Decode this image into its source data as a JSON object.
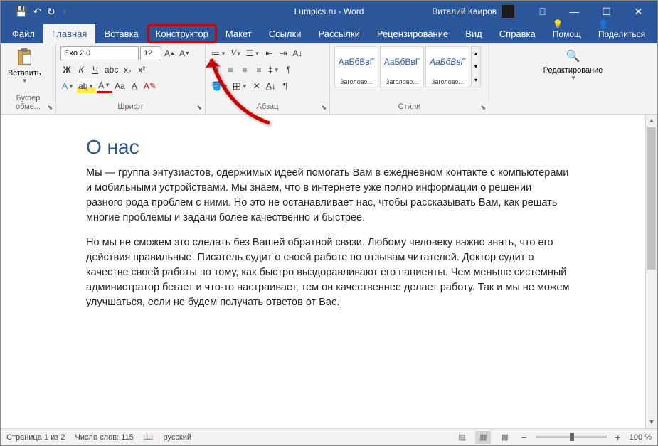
{
  "titlebar": {
    "title": "Lumpics.ru - Word",
    "user": "Виталий Каиров"
  },
  "tabs": {
    "file": "Файл",
    "home": "Главная",
    "insert": "Вставка",
    "design": "Конструктор",
    "layout": "Макет",
    "references": "Ссылки",
    "mailings": "Рассылки",
    "review": "Рецензирование",
    "view": "Вид",
    "help": "Справка",
    "tell_me": "Помощ",
    "share": "Поделиться"
  },
  "ribbon": {
    "clipboard": {
      "paste": "Вставить",
      "group": "Буфер обме..."
    },
    "font": {
      "name": "Exo 2.0",
      "size": "12",
      "group": "Шрифт",
      "bold": "Ж",
      "italic": "К",
      "underline": "Ч",
      "strike": "abc",
      "sub": "x₂",
      "sup": "x²",
      "grow": "A",
      "shrink": "A",
      "case": "Aa",
      "clear": "A"
    },
    "paragraph": {
      "group": "Абзац"
    },
    "styles": {
      "group": "Стили",
      "preview": "АаБбВвГ",
      "items": [
        "Заголово...",
        "Заголово...",
        "Заголово..."
      ]
    },
    "editing": {
      "label": "Редактирование"
    }
  },
  "document": {
    "heading": "О нас",
    "p1": "Мы — группа энтузиастов, одержимых идеей помогать Вам в ежедневном контакте с компьютерами и мобильными устройствами. Мы знаем, что в интернете уже полно информации о решении разного рода проблем с ними. Но это не останавливает нас, чтобы рассказывать Вам, как решать многие проблемы и задачи более качественно и быстрее.",
    "p2": "Но мы не сможем это сделать без Вашей обратной связи. Любому человеку важно знать, что его действия правильные. Писатель судит о своей работе по отзывам читателей. Доктор судит о качестве своей работы по тому, как быстро выздоравливают его пациенты. Чем меньше системный администратор бегает и что-то настраивает, тем он качественнее делает работу. Так и мы не можем улучшаться, если не будем получать ответов от Вас."
  },
  "statusbar": {
    "page": "Страница 1 из 2",
    "words": "Число слов: 115",
    "lang": "русский",
    "zoom": "100 %"
  }
}
